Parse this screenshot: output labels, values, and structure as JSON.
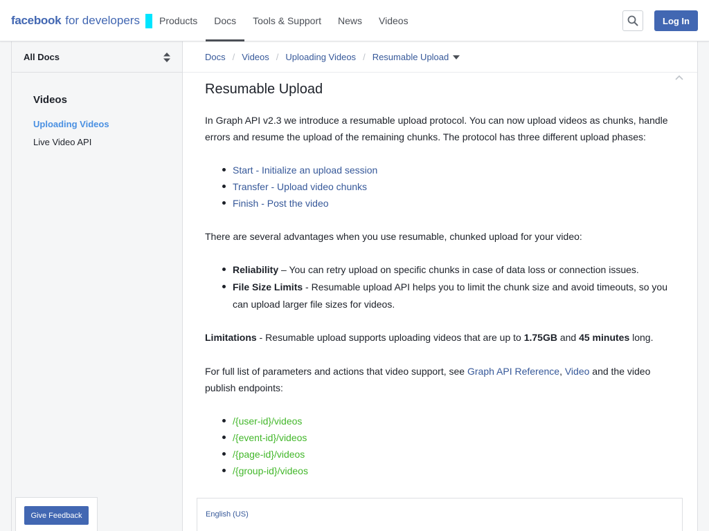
{
  "header": {
    "logo_bold": "facebook",
    "logo_light": "for developers",
    "nav": [
      "Products",
      "Docs",
      "Tools & Support",
      "News",
      "Videos"
    ],
    "active_nav": "Docs",
    "login_label": "Log In",
    "brand_color": "#4267b2",
    "accent_color": "#00e5ff"
  },
  "sidebar": {
    "selector_label": "All Docs",
    "section_title": "Videos",
    "items": [
      {
        "label": "Uploading Videos",
        "active": true
      },
      {
        "label": "Live Video API",
        "active": false
      }
    ]
  },
  "breadcrumb": {
    "items": [
      "Docs",
      "Videos",
      "Uploading Videos",
      "Resumable Upload"
    ]
  },
  "article": {
    "title": "Resumable Upload",
    "intro": "In Graph API v2.3 we introduce a resumable upload protocol. You can now upload videos as chunks, handle errors and resume the upload of the remaining chunks. The protocol has three different upload phases:",
    "phases": [
      "Start - Initialize an upload session",
      "Transfer - Upload video chunks",
      "Finish - Post the video"
    ],
    "advantages_intro": "There are several advantages when you use resumable, chunked upload for your video:",
    "advantages": [
      {
        "term": "Reliability",
        "text": " – You can retry upload on specific chunks in case of data loss or connection issues."
      },
      {
        "term": "File Size Limits",
        "text": " - Resumable upload API helps you to limit the chunk size and avoid timeouts, so you can upload larger file sizes for videos."
      }
    ],
    "limitations": {
      "term": "Limitations",
      "text_a": " - Resumable upload supports uploading videos that are up to ",
      "size": "1.75GB",
      "text_b": " and ",
      "duration": "45 minutes",
      "text_c": " long."
    },
    "reference": {
      "text_a": "For full list of parameters and actions that video support, see ",
      "link1": "Graph API Reference",
      "sep": ", ",
      "link2": "Video",
      "text_b": " and the video publish endpoints:"
    },
    "endpoints": [
      "/{user-id}/videos",
      "/{event-id}/videos",
      "/{page-id}/videos",
      "/{group-id}/videos"
    ]
  },
  "footer": {
    "feedback_label": "Give Feedback",
    "language": "English (US)"
  }
}
